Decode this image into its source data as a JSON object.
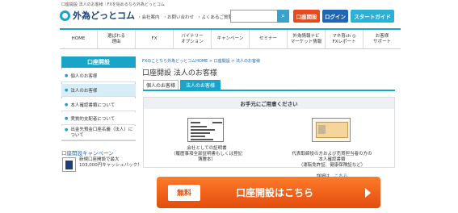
{
  "header": {
    "tagline": "口座開設 法人のお客様｜FXを始めるなら外為どっとコム",
    "logo_text": "外為どっとコム",
    "utility_links": [
      "・会社案内",
      "・お問い合わせ",
      "・よくあるご質問"
    ],
    "search_placeholder": "",
    "open_account": "口座開設",
    "login": "ログイン",
    "start_guide": "スタートガイド"
  },
  "nav": {
    "items": [
      "HOME",
      "選ばれる\n理由",
      "FX",
      "バイナリー\nオプション",
      "キャンペーン",
      "セミナー",
      "外為情報ナビ\nマーケット情報",
      "マネ育ch ◎\nFXレポート",
      "お客様\nサポート"
    ]
  },
  "sidebar": {
    "heading": "口座開設",
    "items": [
      "個人のお客様",
      "法人のお客様",
      "本人確認書類について",
      "実質的支配者について",
      "出金先預金口座名義（法人）について"
    ],
    "active_index": 1,
    "campaign_title": "口座開設キャンペーン",
    "campaign_text": "新規口座開設で最大\n103,000円キャッシュバック！"
  },
  "main": {
    "breadcrumb": "FXのことなら外為どっとコムHOME > 口座開設 > 法人のお客様",
    "title": "口座開設 法人のお客様",
    "tab_individual": "個人のお客様",
    "tab_corporate": "法人のお客様",
    "docs_heading": "お手元にご用意ください",
    "doc1_caption": "会社としての証明書\n（履歴事項全部証明書もしくは登記簿謄本）",
    "doc2_caption": "代表取締役の方および売買担当者の方の本人確認書類\n（運転免許証、健康保険証など）",
    "doc2_more_label": "詳細は、",
    "doc2_more_link": "こちら"
  },
  "cta": {
    "free": "無料",
    "label": "口座開設はこちら"
  },
  "colors": {
    "accent": "#1aa5c8",
    "cta_orange": "#e94a1d",
    "login_blue": "#1f66b6"
  }
}
